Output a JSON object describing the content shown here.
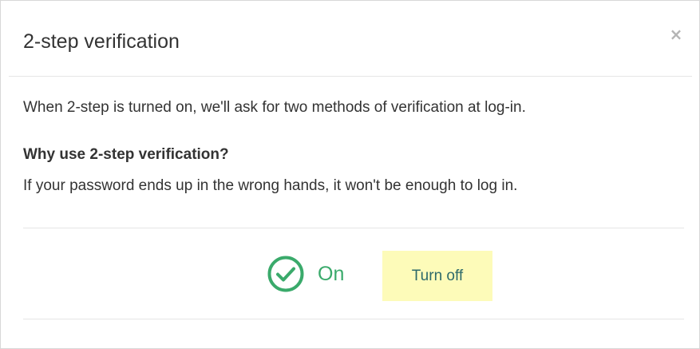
{
  "dialog": {
    "title": "2-step verification",
    "close_label": "×"
  },
  "content": {
    "intro": "When 2-step is turned on, we'll ask for two methods of verification at log-in.",
    "why_heading": "Why use 2-step verification?",
    "why_text": "If your password ends up in the wrong hands, it won't be enough to log in."
  },
  "status": {
    "label": "On",
    "icon": "check-circle-icon",
    "color": "#3aaa6b"
  },
  "actions": {
    "turn_off_label": "Turn off",
    "button_bg": "#fdfbb9"
  }
}
